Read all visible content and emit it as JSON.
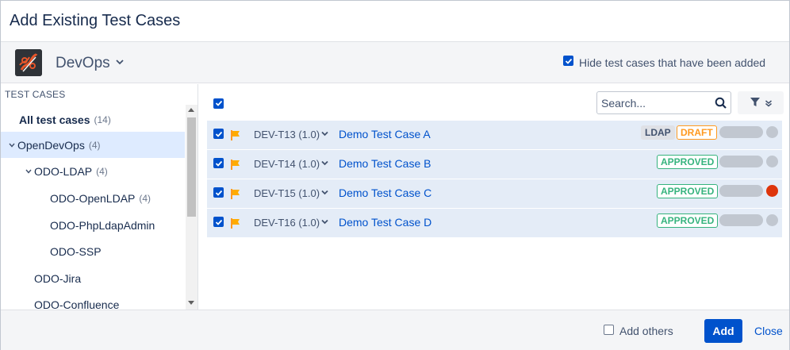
{
  "dialog": {
    "title": "Add Existing Test Cases"
  },
  "project": {
    "name": "DevOps",
    "avatar_icon": "devops-logo-icon",
    "hide_added": {
      "label": "Hide test cases that have been added",
      "checked": true
    }
  },
  "tree": {
    "header": "TEST CASES",
    "items": [
      {
        "label": "All test cases",
        "count": "(14)"
      },
      {
        "label": "OpenDevOps",
        "count": "(4)"
      },
      {
        "label": "ODO-LDAP",
        "count": "(4)"
      },
      {
        "label": "ODO-OpenLDAP",
        "count": "(4)"
      },
      {
        "label": "ODO-PhpLdapAdmin",
        "count": ""
      },
      {
        "label": "ODO-SSP",
        "count": ""
      },
      {
        "label": "ODO-Jira",
        "count": ""
      },
      {
        "label": "ODO-Confluence",
        "count": ""
      }
    ]
  },
  "search": {
    "placeholder": "Search...",
    "value": ""
  },
  "rows": [
    {
      "key": "DEV-T13 (1.0)",
      "name": "Demo Test Case A",
      "labels": [
        "LDAP"
      ],
      "status": "DRAFT",
      "dot": "grey",
      "checked": true
    },
    {
      "key": "DEV-T14 (1.0)",
      "name": "Demo Test Case B",
      "labels": [],
      "status": "APPROVED",
      "dot": "grey",
      "checked": true
    },
    {
      "key": "DEV-T15 (1.0)",
      "name": "Demo Test Case C",
      "labels": [],
      "status": "APPROVED",
      "dot": "red",
      "checked": true
    },
    {
      "key": "DEV-T16 (1.0)",
      "name": "Demo Test Case D",
      "labels": [],
      "status": "APPROVED",
      "dot": "grey",
      "checked": true
    }
  ],
  "footer": {
    "add_others": {
      "label": "Add others",
      "checked": false
    },
    "add_label": "Add",
    "close_label": "Close"
  },
  "colors": {
    "primary": "#0052cc",
    "draft": "#ff991f",
    "approved": "#36b37e",
    "red_dot": "#de350b",
    "row_bg": "#e4ecf7"
  }
}
